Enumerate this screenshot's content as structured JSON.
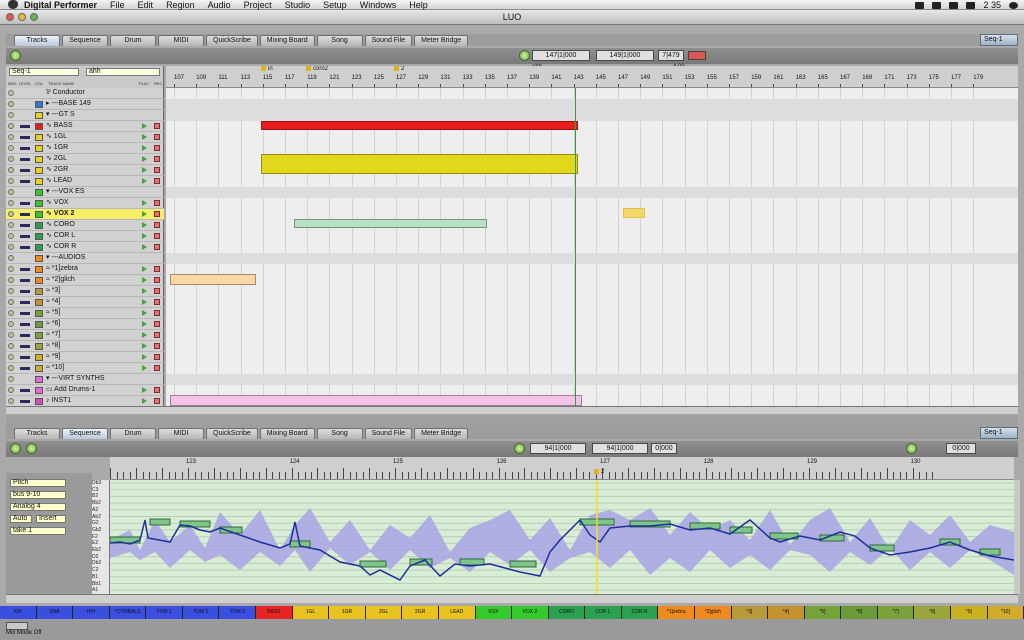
{
  "menubar": {
    "app_name": "Digital Performer",
    "items": [
      "File",
      "Edit",
      "Region",
      "Audio",
      "Project",
      "Studio",
      "Setup",
      "Windows",
      "Help"
    ],
    "clock": "2 35"
  },
  "window": {
    "title": "LUO"
  },
  "tabs": [
    "Tracks",
    "Sequence",
    "Drum",
    "MIDI",
    "QuickScribe",
    "Mixing Board",
    "Song",
    "Sound File",
    "Meter Bridge"
  ],
  "top_panel": {
    "active_tab": "Tracks",
    "sequence": "Seq-1",
    "start_time": "147|1|000",
    "end_time": "149|1|000",
    "length": "7|479",
    "marker_top": "ahh",
    "marker_top2": "4 00",
    "header": {
      "seq_menu": "Seq-1",
      "marker_menu": "ahh",
      "columns": [
        "MIDI",
        "LEVEL",
        "COL",
        "TRACK NAME",
        "PLAY",
        "REC"
      ]
    },
    "ruler_bars": [
      "107",
      "109",
      "111",
      "113",
      "115",
      "117",
      "119",
      "121",
      "123",
      "125",
      "127",
      "129",
      "131",
      "133",
      "135",
      "137",
      "139",
      "141",
      "143",
      "145",
      "147",
      "149",
      "151",
      "153",
      "155",
      "157",
      "159",
      "161",
      "163",
      "165",
      "167",
      "169",
      "171",
      "173",
      "175",
      "177",
      "179"
    ],
    "markers": [
      {
        "label": "in"
      },
      {
        "label": "coro2"
      },
      {
        "label": "2"
      }
    ],
    "tracks": [
      {
        "name": "Conductor",
        "color": "",
        "prefix": "⅌"
      },
      {
        "name": "---BASE  149",
        "color": "#2f78d8",
        "prefix": "▸"
      },
      {
        "name": "---GT S",
        "color": "#e8d21e",
        "prefix": "▾"
      },
      {
        "name": "BASS",
        "color": "#e81e1e",
        "prefix": "∿"
      },
      {
        "name": "1GL",
        "color": "#e8d21e",
        "prefix": "∿"
      },
      {
        "name": "1GR",
        "color": "#e8d21e",
        "prefix": "∿"
      },
      {
        "name": "2GL",
        "color": "#e8d21e",
        "prefix": "∿"
      },
      {
        "name": "2GR",
        "color": "#e8d21e",
        "prefix": "∿"
      },
      {
        "name": "LEAD",
        "color": "#e8d21e",
        "prefix": "∿"
      },
      {
        "name": "---VOX ES",
        "color": "#36c92c",
        "prefix": "▾"
      },
      {
        "name": "VOX",
        "color": "#36c92c",
        "prefix": "∿"
      },
      {
        "name": "VOX 2",
        "color": "#36c92c",
        "prefix": "∿"
      },
      {
        "name": "CORO",
        "color": "#2aa050",
        "prefix": "∿"
      },
      {
        "name": "COR L",
        "color": "#2aa050",
        "prefix": "∿"
      },
      {
        "name": "COR R",
        "color": "#2aa050",
        "prefix": "∿"
      },
      {
        "name": "---AUDIOS",
        "color": "#ee8a1e",
        "prefix": "▾"
      },
      {
        "name": "*1]zebra",
        "color": "#ee8a1e",
        "prefix": "≈"
      },
      {
        "name": "*2]glich",
        "color": "#ee8a1e",
        "prefix": "≈"
      },
      {
        "name": "*3]",
        "color": "#b99a3a",
        "prefix": "≈"
      },
      {
        "name": "*4]",
        "color": "#c4922e",
        "prefix": "≈"
      },
      {
        "name": "*5]",
        "color": "#76a23a",
        "prefix": "≈"
      },
      {
        "name": "*6]",
        "color": "#6a9a3a",
        "prefix": "≈"
      },
      {
        "name": "*7]",
        "color": "#7aa23a",
        "prefix": "≈"
      },
      {
        "name": "*8]",
        "color": "#9aa63a",
        "prefix": "≈"
      },
      {
        "name": "*9]",
        "color": "#c9b21e",
        "prefix": "≈"
      },
      {
        "name": "*10]",
        "color": "#d0ac2a",
        "prefix": "≈"
      },
      {
        "name": "---VIRT SYNTHS",
        "color": "#e86ad8",
        "prefix": "▾"
      },
      {
        "name": "Add Drums-1",
        "color": "#e86ad8",
        "prefix": "▭"
      },
      {
        "name": "INST1",
        "color": "#d84ab8",
        "prefix": "♪"
      }
    ]
  },
  "bottom_panel": {
    "active_tab": "Sequence",
    "sequence": "Seq-1",
    "start_time": "94|1|000",
    "end_time": "94|1|000",
    "length": "0|000",
    "clock": "0|000",
    "ruler_bars": [
      "123",
      "124",
      "125",
      "126",
      "127",
      "128",
      "129",
      "130"
    ],
    "marker": "2",
    "left_controls": [
      "Pitch",
      "bus 9-10",
      "Analog 4",
      "Auto",
      "Insert",
      "take 1"
    ],
    "pitch_keys": [
      "Db3",
      "C3",
      "B2",
      "Bb2",
      "A2",
      "Ab2",
      "G2",
      "Gb2",
      "F2",
      "E2",
      "Eb2",
      "D2",
      "Db2",
      "C2",
      "B1",
      "Bb1",
      "A1"
    ]
  },
  "channel_strip": [
    {
      "name": "KIK",
      "color": "#3a4ee0"
    },
    {
      "name": "SNA",
      "color": "#3a4ee0"
    },
    {
      "name": "HIH",
      "color": "#3a4ee0"
    },
    {
      "name": "*CYMBALS",
      "color": "#3a4ee0"
    },
    {
      "name": "TOM 1",
      "color": "#3a4ee0"
    },
    {
      "name": "TOM 2",
      "color": "#3a4ee0"
    },
    {
      "name": "TOM 3",
      "color": "#3a4ee0"
    },
    {
      "name": "BASS",
      "color": "#e82424"
    },
    {
      "name": "1GL",
      "color": "#e8c21e"
    },
    {
      "name": "1GR",
      "color": "#e8c21e"
    },
    {
      "name": "2GL",
      "color": "#e8c21e"
    },
    {
      "name": "2GR",
      "color": "#e8c21e"
    },
    {
      "name": "LEAD",
      "color": "#e8c21e"
    },
    {
      "name": "VOX",
      "color": "#36c92c"
    },
    {
      "name": "VOX 2",
      "color": "#36c92c"
    },
    {
      "name": "CORO",
      "color": "#2aa050"
    },
    {
      "name": "COR L",
      "color": "#2aa050"
    },
    {
      "name": "COR R",
      "color": "#2aa050"
    },
    {
      "name": "*1]zebra",
      "color": "#ee8a1e"
    },
    {
      "name": "*2]glich",
      "color": "#ee8a1e"
    },
    {
      "name": "*3]",
      "color": "#b99a3a"
    },
    {
      "name": "*4]",
      "color": "#c4922e"
    },
    {
      "name": "*5]",
      "color": "#76a23a"
    },
    {
      "name": "*6]",
      "color": "#6a9a3a"
    },
    {
      "name": "*7]",
      "color": "#7aa23a"
    },
    {
      "name": "*8]",
      "color": "#9aa63a"
    },
    {
      "name": "*9]",
      "color": "#c9b21e"
    },
    {
      "name": "*10]",
      "color": "#d0ac2a"
    }
  ],
  "footer": {
    "mix_mode": "Mix Mode Off"
  }
}
